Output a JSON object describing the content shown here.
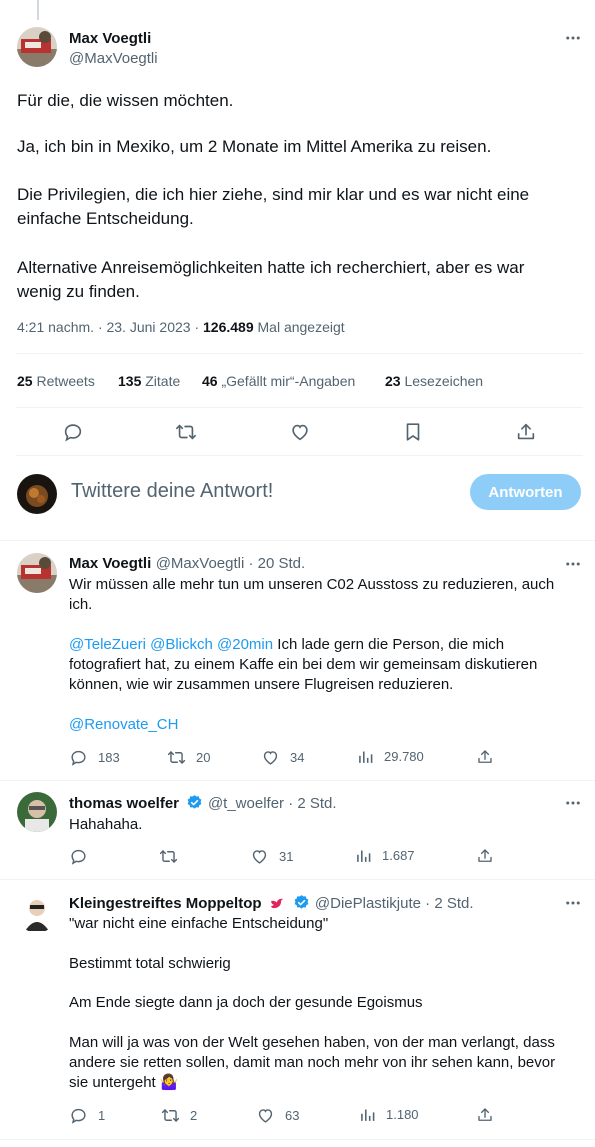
{
  "main_tweet": {
    "author_name": "Max Voegtli",
    "author_handle": "@MaxVoegtli",
    "paragraphs": [
      "Für die, die wissen möchten.",
      "Ja, ich bin in Mexiko, um 2 Monate im Mittel Amerika zu reisen.",
      "Die Privilegien, die ich hier ziehe, sind mir klar und es war nicht eine",
      "einfache Entscheidung.",
      "Alternative Anreisemöglichkeiten hatte ich recherchiert, aber es war",
      "wenig zu finden."
    ],
    "timestamp": "4:21 nachm. · 23. Juni 2023 · ",
    "views_count": "126.489",
    "views_label": " Mal angezeigt",
    "stats": {
      "retweets_count": "25",
      "retweets_label": " Retweets",
      "quotes_count": "135",
      "quotes_label": " Zitate",
      "likes_count": "46",
      "likes_label": " „Gefällt mir“-Angaben",
      "bookmarks_count": "23",
      "bookmarks_label": " Lesezeichen"
    }
  },
  "compose": {
    "placeholder": "Twittere deine Antwort!",
    "button_label": "Antworten"
  },
  "replies": [
    {
      "author_name": "Max Voegtli",
      "author_handle": "@MaxVoegtli",
      "time": " · 20 Std.",
      "lines": [
        "Wir müssen alle mehr tun um unseren C02 Ausstoss zu reduzieren, auch",
        "ich."
      ],
      "mentions": [
        "@TeleZueri",
        "@Blickch",
        "@20min"
      ],
      "mention_text_1": " Ich lade gern die Person, die mich",
      "mention_lines": [
        "fotografiert hat, zu einem Kaffe ein bei dem wir gemeinsam diskutieren",
        "können, wie wir zusammen unsere Flugreisen reduzieren."
      ],
      "final_mention": "@Renovate_CH",
      "actions": {
        "replies": "183",
        "retweets": "20",
        "likes": "34",
        "views": "29.780"
      }
    },
    {
      "author_name": "thomas woelfer",
      "author_handle": "@t_woelfer",
      "time": " · 2 Std.",
      "text": "Hahahaha.",
      "actions": {
        "replies": "",
        "retweets": "",
        "likes": "31",
        "views": "1.687"
      }
    },
    {
      "author_name": "Kleingestreiftes Moppeltop",
      "author_handle": "@DiePlastikjute",
      "time": " · 2 Std.",
      "lines": [
        "\"war nicht eine einfache Entscheidung\"",
        "Bestimmt total schwierig",
        "Am Ende siegte dann ja doch der gesunde Egoismus",
        "Man will ja was von der Welt gesehen haben, von der man verlangt, dass",
        "andere sie retten sollen, damit man noch mehr von ihr sehen kann, bevor",
        "sie untergeht"
      ],
      "emoji": "🤷‍♀️",
      "actions": {
        "replies": "1",
        "retweets": "2",
        "likes": "63",
        "views": "1.180"
      }
    }
  ],
  "colors": {
    "accent": "#1d9bf0",
    "button_disabled": "#8ecdf8",
    "muted": "#536471",
    "text": "#0f1419",
    "verified": "#1d9bf0"
  },
  "icons": [
    "more-icon",
    "reply-icon",
    "retweet-icon",
    "like-icon",
    "bookmark-icon",
    "share-icon",
    "views-icon",
    "verified-icon",
    "bird-emoji-icon"
  ]
}
